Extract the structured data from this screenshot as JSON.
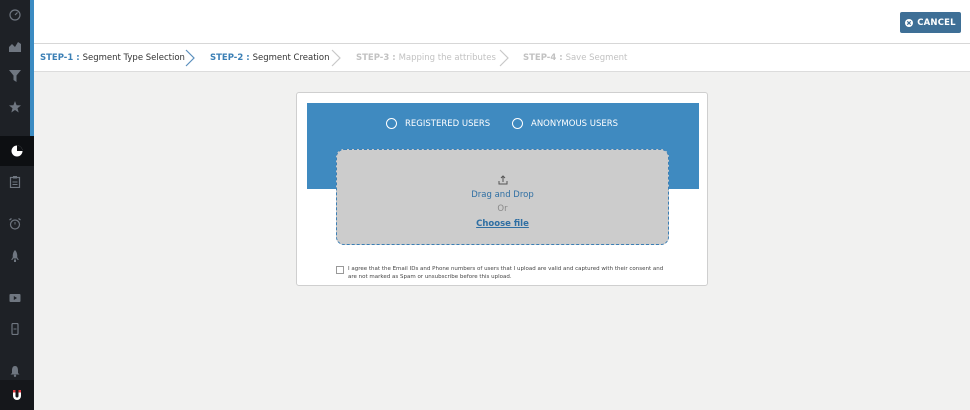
{
  "header": {
    "cancel_label": "CANCEL"
  },
  "steps": [
    {
      "num": "STEP-1",
      "name": "Segment Type Selection",
      "state": "done"
    },
    {
      "num": "STEP-2",
      "name": "Segment Creation",
      "state": "current"
    },
    {
      "num": "STEP-3",
      "name": "Mapping the attributes",
      "state": "todo"
    },
    {
      "num": "STEP-4",
      "name": "Save Segment",
      "state": "todo"
    }
  ],
  "step_separator": " : ",
  "user_types": [
    {
      "label": "REGISTERED USERS"
    },
    {
      "label": "ANONYMOUS USERS"
    }
  ],
  "upload": {
    "drag_label": "Drag and Drop",
    "or_label": "Or",
    "choose_label": "Choose file"
  },
  "consent_text": "I agree that the Email IDs and Phone numbers of users that I upload are valid and captured with their consent and are not marked as Spam or unsubscribe before this upload.",
  "sidebar": {
    "icons": [
      "dashboard-icon",
      "analytics-icon",
      "funnel-icon",
      "star-icon",
      "segment-pie-icon",
      "clipboard-icon",
      "alarm-icon",
      "rocket-icon",
      "video-icon",
      "mobile-icon",
      "bell-icon",
      "brand-logo-icon"
    ]
  },
  "colors": {
    "accent": "#3b8bc2",
    "panel": "#3f8ac0",
    "cancel": "#3e6f96"
  }
}
